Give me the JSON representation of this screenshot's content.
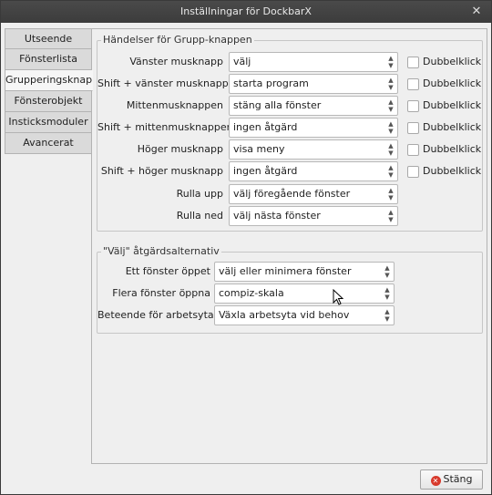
{
  "window": {
    "title": "Inställningar för DockbarX"
  },
  "tabs": [
    {
      "label": "Utseende",
      "active": false
    },
    {
      "label": "Fönsterlista",
      "active": false
    },
    {
      "label": "Grupperingsknapp",
      "active": true
    },
    {
      "label": "Fönsterobjekt",
      "active": false
    },
    {
      "label": "Insticksmoduler",
      "active": false
    },
    {
      "label": "Avancerat",
      "active": false
    }
  ],
  "group_events": {
    "legend": "Händelser för Grupp-knappen",
    "checkbox_label": "Dubbelklick",
    "rows": [
      {
        "label": "Vänster musknapp",
        "value": "välj",
        "has_checkbox": true,
        "checked": false
      },
      {
        "label": "Shift + vänster musknapp",
        "value": "starta program",
        "has_checkbox": true,
        "checked": false
      },
      {
        "label": "Mittenmusknappen",
        "value": "stäng alla fönster",
        "has_checkbox": true,
        "checked": false
      },
      {
        "label": "Shift + mittenmusknappen",
        "value": "ingen åtgärd",
        "has_checkbox": true,
        "checked": false
      },
      {
        "label": "Höger musknapp",
        "value": "visa meny",
        "has_checkbox": true,
        "checked": false
      },
      {
        "label": "Shift + höger musknapp",
        "value": "ingen åtgärd",
        "has_checkbox": true,
        "checked": false
      },
      {
        "label": "Rulla upp",
        "value": "välj föregående fönster",
        "has_checkbox": false
      },
      {
        "label": "Rulla ned",
        "value": "välj nästa fönster",
        "has_checkbox": false
      }
    ]
  },
  "select_options": {
    "legend": "\"Välj\" åtgärdsalternativ",
    "rows": [
      {
        "label": "Ett fönster öppet",
        "value": "välj eller minimera fönster"
      },
      {
        "label": "Flera fönster öppna",
        "value": "compiz-skala"
      },
      {
        "label": "Beteende för arbetsyta",
        "value": "Växla arbetsyta vid behov"
      }
    ]
  },
  "footer": {
    "close_label": "Stäng"
  },
  "colors": {
    "titlebar": "#3c3c3c",
    "close_icon": "#d83a2c",
    "active_tab": "#f6f6f6"
  }
}
